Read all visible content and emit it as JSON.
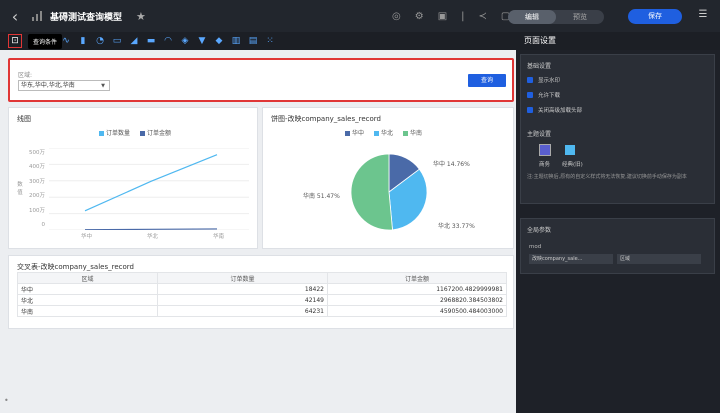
{
  "app": {
    "title": "基碍测试查询模型"
  },
  "topbar": {
    "seg_edit": "编辑",
    "seg_preview": "预览",
    "save": "保存"
  },
  "tooltip": "查询条件",
  "filter": {
    "label": "区域:",
    "value": "华东,华中,华北,华南",
    "query": "查询"
  },
  "line_panel": {
    "title": "线图",
    "legend": [
      "订单数量",
      "订单金额"
    ],
    "y_ticks": [
      "500万",
      "400万",
      "300万",
      "200万",
      "100万",
      "0"
    ],
    "x_ticks": [
      "华中",
      "华北",
      "华南"
    ],
    "ylabel": "数值"
  },
  "pie_panel": {
    "title": "饼图-改映company_sales_record",
    "legend": [
      "华中",
      "华北",
      "华南"
    ],
    "labels": [
      "华中 14.76%",
      "华北 33.77%",
      "华南 51.47%"
    ]
  },
  "chart_data": [
    {
      "type": "line",
      "categories": [
        "华中",
        "华北",
        "华南"
      ],
      "series": [
        {
          "name": "订单数量",
          "values": [
            18422,
            42149,
            64231
          ]
        },
        {
          "name": "订单金额",
          "values": [
            1167200.48,
            2968820.38,
            4590500.48
          ]
        }
      ],
      "ylim": [
        0,
        5000000
      ]
    },
    {
      "type": "pie",
      "categories": [
        "华中",
        "华北",
        "华南"
      ],
      "values": [
        14.76,
        33.77,
        51.47
      ]
    }
  ],
  "table": {
    "title": "交叉表-改映company_sales_record",
    "headers": [
      "区域",
      "订单数量",
      "订单金额"
    ],
    "rows": [
      [
        "华中",
        "18422",
        "1167200.4829999981"
      ],
      [
        "华北",
        "42149",
        "2968820.384503802"
      ],
      [
        "华南",
        "64231",
        "4590500.484003000"
      ]
    ]
  },
  "side": {
    "title": "页面设置",
    "basic": "基础设置",
    "opts": [
      "显示水印",
      "允许下载",
      "关闭高级加载头部"
    ],
    "theme_title": "主题设置",
    "themes": [
      "商务",
      "经典(旧)"
    ],
    "note": "注:主题切换后,原有的自定义样式将无法恢复,建议切换前手动保存为副本",
    "global": "全局参数",
    "param": "mod",
    "param_field": "改映company_sale...",
    "param_target": "区域"
  },
  "colors": {
    "blue": "#1f5fe0",
    "red": "#e03636",
    "pie": [
      "#4a6aa8",
      "#4fb8f0",
      "#6cc58e"
    ],
    "line": "#4fb8f0"
  }
}
